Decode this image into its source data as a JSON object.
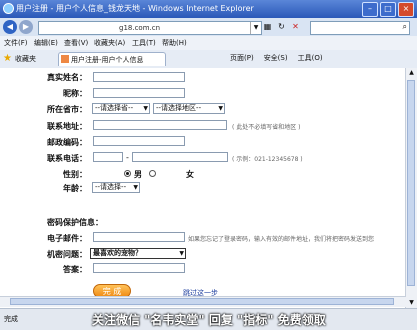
{
  "window": {
    "title": "用户注册 - 用户个人信息_钱龙天地 - Windows Internet Explorer"
  },
  "address": {
    "url": "g18.com.cn"
  },
  "menu": [
    "文件(F)",
    "编辑(E)",
    "查看(V)",
    "收藏夹(A)",
    "工具(T)",
    "帮助(H)"
  ],
  "favbar": {
    "label": "收藏夹",
    "tab_title": "用户注册-用户个人信息"
  },
  "commands": [
    "页面(P)",
    "安全(S)",
    "工具(O)"
  ],
  "form": {
    "real_name": "真实姓名：",
    "nickname": "昵称：",
    "city": "所在省市：",
    "province_placeholder": "--请选择省--",
    "region_placeholder": "--请选择地区--",
    "address": "联系地址：",
    "address_hint": "( 此处不必填写省和地区 )",
    "zip": "邮政编码：",
    "phone": "联系电话：",
    "phone_sep": "-",
    "phone_hint": "( 示例：021-12345678 )",
    "gender": "性别：",
    "male": "男",
    "female": "女",
    "age": "年龄：",
    "age_placeholder": "--请选择--",
    "security_title": "密码保护信息：",
    "email": "电子邮件：",
    "email_hint": "如果您忘记了登录密码，输入有效的邮件地址，我们将把密码发送到您",
    "question": "机密问题：",
    "question_value": "最喜欢的宠物？",
    "answer": "答案：",
    "save": "完  成",
    "skip": "跳过这一步"
  },
  "status": {
    "text": "完成",
    "watermark": "关注微信 \"名韦实堂\" 回复 \"指标\" 免费领取"
  }
}
